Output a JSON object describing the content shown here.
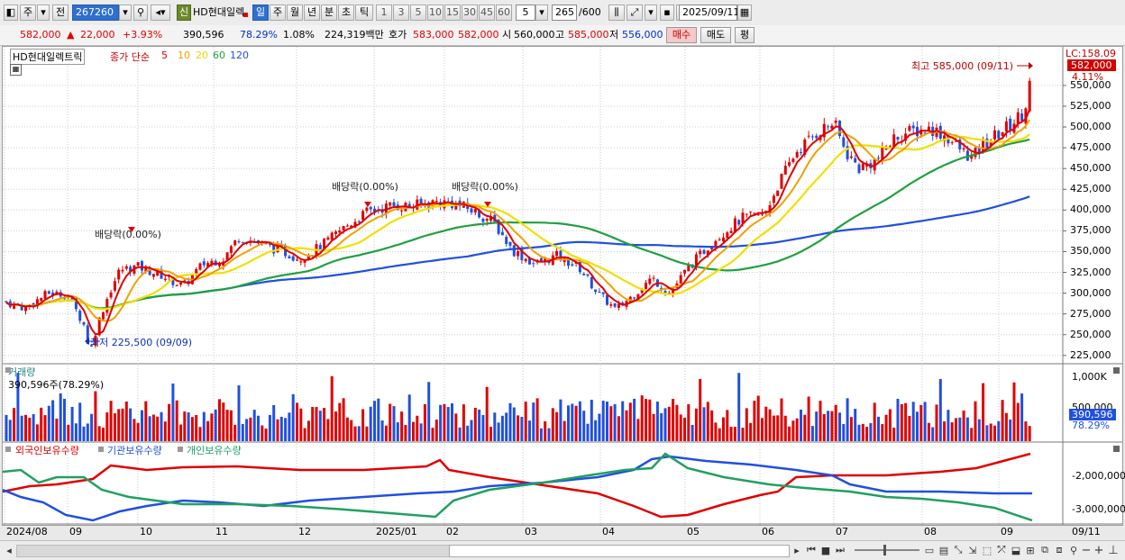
{
  "toolbar": {
    "tab_stock": "주",
    "tab_prev": "전",
    "code_value": "267260",
    "stock_name": "HD현대일렉",
    "badge": "신",
    "periods": [
      "일",
      "주",
      "월",
      "년",
      "분",
      "초",
      "틱"
    ],
    "selected_period": "일",
    "intervals": [
      "1",
      "3",
      "5",
      "10",
      "15",
      "30",
      "45",
      "60"
    ],
    "interval_value": "5",
    "count_value": "265",
    "count_total": "/600",
    "date_value": "2025/09/11"
  },
  "quote": {
    "price": "582,000",
    "change": "22,000",
    "change_pct": "+3.93%",
    "volume": "390,596",
    "vol_ratio": "78.29%",
    "turnover": "1.08%",
    "amount": "224,319백만",
    "bid_label": "호가",
    "ask": "583,000",
    "bid": "582,000",
    "open_label": "시",
    "open": "560,000",
    "high_label": "고",
    "high": "585,000",
    "low_label": "저",
    "low": "556,000",
    "buy_btn": "매수",
    "sell_btn": "매도",
    "eval_btn": "평"
  },
  "legend": {
    "name": "HD현대일렉트릭",
    "ma_label": "종가 단순",
    "ma_periods": [
      "5",
      "10",
      "20",
      "60",
      "120"
    ],
    "ma_colors": [
      "#e00000",
      "#f0a000",
      "#f0e000",
      "#20a040",
      "#2050e0"
    ]
  },
  "annotations": {
    "high": "최고 585,000 (09/11)",
    "low": "최저 225,500 (09/09)",
    "dividend1": "배당락(0.00%)",
    "dividend2": "배당락(0.00%)",
    "dividend3": "배당락(0.00%)"
  },
  "price_axis": {
    "lc": "LC:158.09",
    "current": "582,000",
    "current_pct": "4.11%",
    "ticks": [
      "550,000",
      "525,000",
      "500,000",
      "475,000",
      "450,000",
      "425,000",
      "400,000",
      "375,000",
      "350,000",
      "325,000",
      "300,000",
      "275,000",
      "250,000",
      "225,000"
    ]
  },
  "volume_panel": {
    "title": "거래량",
    "value": "390,596주(78.29%)",
    "ticks": [
      "1,000K",
      "500,000"
    ],
    "current": "390,596",
    "current_pct": "78.29%"
  },
  "holdings_panel": {
    "series": [
      "외국인보유수량",
      "기관보유수량",
      "개인보유수량"
    ],
    "colors": [
      "#e00000",
      "#2050e0",
      "#20a060"
    ],
    "ticks": [
      "-2,000,000",
      "-3,000,000"
    ]
  },
  "x_axis": {
    "labels": [
      "2024/08",
      "09",
      "10",
      "11",
      "12",
      "2025/01",
      "02",
      "03",
      "04",
      "05",
      "06",
      "07",
      "08",
      "09"
    ],
    "current": "09/11"
  },
  "chart_data": {
    "type": "candlestick",
    "title": "HD현대일렉트릭",
    "x": [
      "2024/08",
      "09",
      "10",
      "11",
      "12",
      "2025/01",
      "02",
      "03",
      "04",
      "05",
      "06",
      "07",
      "08",
      "09"
    ],
    "close_path_points": [
      [
        "2024/08",
        290000
      ],
      [
        "09",
        262000
      ],
      [
        "09",
        226000
      ],
      [
        "09",
        285000
      ],
      [
        "10",
        320000
      ],
      [
        "10",
        332000
      ],
      [
        "11",
        338000
      ],
      [
        "11",
        345000
      ],
      [
        "12",
        352000
      ],
      [
        "12",
        360000
      ],
      [
        "2025/01",
        395000
      ],
      [
        "2025/01",
        405000
      ],
      [
        "02",
        410000
      ],
      [
        "02",
        395000
      ],
      [
        "03",
        350000
      ],
      [
        "03",
        330000
      ],
      [
        "04",
        300000
      ],
      [
        "04",
        275000
      ],
      [
        "05",
        310000
      ],
      [
        "05",
        360000
      ],
      [
        "06",
        410000
      ],
      [
        "06",
        475000
      ],
      [
        "07",
        510000
      ],
      [
        "07",
        460000
      ],
      [
        "08",
        495000
      ],
      [
        "08",
        465000
      ],
      [
        "09",
        500000
      ],
      [
        "09",
        582000
      ]
    ],
    "ma_values_at_end": {
      "5": 535000,
      "10": 515000,
      "20": 505000,
      "60": 485000,
      "120": 415000
    },
    "y_range": [
      215000,
      590000
    ],
    "high": {
      "value": 585000,
      "date": "09/11"
    },
    "low": {
      "value": 225500,
      "date": "09/09"
    }
  }
}
